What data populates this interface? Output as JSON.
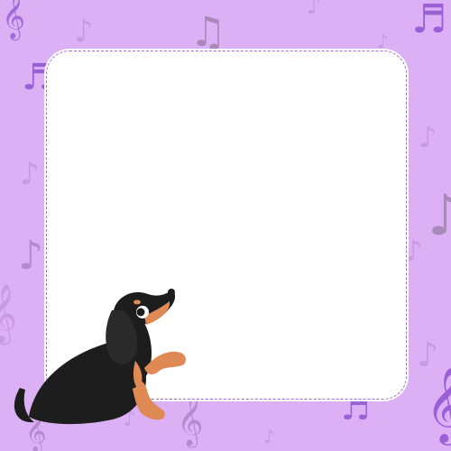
{
  "theme": {
    "background": "#dcb0f4",
    "frame_fill": "#ffffff",
    "frame_border": "#a46ad8",
    "note_light": "#c79ae6",
    "note_dark": "#9b5fd6",
    "note_muted": "#a989b8"
  },
  "decorations": {
    "notes": [
      {
        "glyph": "𝄞",
        "name": "treble-clef-icon"
      },
      {
        "glyph": "♪",
        "name": "eighth-note-icon"
      },
      {
        "glyph": "♫",
        "name": "beamed-notes-icon"
      },
      {
        "glyph": "♬",
        "name": "sixteenth-notes-icon"
      }
    ]
  },
  "frame": {
    "content": ""
  },
  "character": {
    "name": "dachshund-illustration"
  }
}
